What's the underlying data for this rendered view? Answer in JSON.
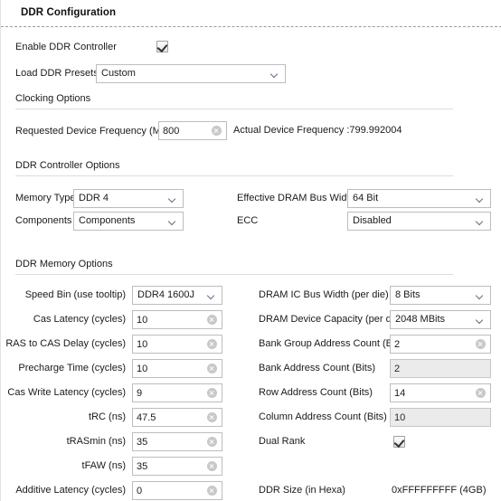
{
  "header": {
    "title": "DDR Configuration"
  },
  "top": {
    "enable_label": "Enable DDR Controller",
    "enable_checked": true,
    "presets_label": "Load DDR Presets",
    "presets_value": "Custom"
  },
  "sections": {
    "clocking": "Clocking Options",
    "controller": "DDR Controller Options",
    "memory": "DDR Memory Options"
  },
  "clocking": {
    "req_freq_label": "Requested Device Frequency (MHz)",
    "req_freq_value": "800",
    "actual_freq_text": "Actual Device Frequency :799.992004"
  },
  "controller": {
    "memory_type_label": "Memory Type",
    "memory_type_value": "DDR 4",
    "components_label": "Components",
    "components_value": "Components",
    "bus_width_label": "Effective DRAM Bus Width",
    "bus_width_value": "64 Bit",
    "ecc_label": "ECC",
    "ecc_value": "Disabled"
  },
  "memory_left": {
    "rows": [
      {
        "label": "Speed Bin (use tooltip)",
        "value": "DDR4 1600J",
        "kind": "select"
      },
      {
        "label": "Cas Latency (cycles)",
        "value": "10",
        "kind": "text"
      },
      {
        "label": "RAS to CAS Delay (cycles)",
        "value": "10",
        "kind": "text"
      },
      {
        "label": "Precharge Time (cycles)",
        "value": "10",
        "kind": "text"
      },
      {
        "label": "Cas Write Latency (cycles)",
        "value": "9",
        "kind": "text"
      },
      {
        "label": "tRC (ns)",
        "value": "47.5",
        "kind": "text"
      },
      {
        "label": "tRASmin (ns)",
        "value": "35",
        "kind": "text"
      },
      {
        "label": "tFAW (ns)",
        "value": "35",
        "kind": "text"
      },
      {
        "label": "Additive Latency (cycles)",
        "value": "0",
        "kind": "text"
      }
    ]
  },
  "memory_right": {
    "rows": [
      {
        "label": "DRAM IC Bus Width (per die)",
        "value": "8 Bits",
        "kind": "select"
      },
      {
        "label": "DRAM Device Capacity (per die)",
        "value": "2048 MBits",
        "kind": "select"
      },
      {
        "label": "Bank Group Address Count (Bits)",
        "value": "2",
        "kind": "text"
      },
      {
        "label": "Bank Address Count (Bits)",
        "value": "2",
        "kind": "text-disabled"
      },
      {
        "label": "Row Address Count (Bits)",
        "value": "14",
        "kind": "text"
      },
      {
        "label": "Column Address Count (Bits)",
        "value": "10",
        "kind": "text-disabled"
      },
      {
        "label": "Dual Rank",
        "value": "",
        "kind": "checkbox"
      },
      {
        "label": "DDR Size (in Hexa)",
        "value": "0xFFFFFFFFF (4GB)",
        "kind": "static"
      }
    ]
  },
  "colors": {
    "field_border": "#bdbdbd",
    "disabled_bg": "#ebebeb",
    "rule": "#dcdcdc",
    "text": "#1a1a1a"
  }
}
